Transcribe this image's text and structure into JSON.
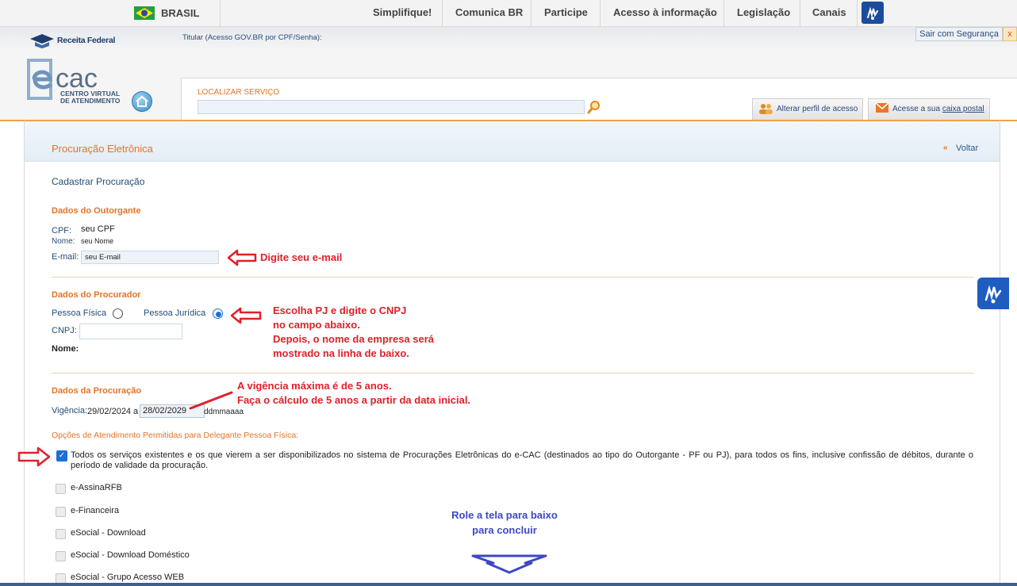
{
  "govbar": {
    "country": "BRASIL",
    "nav": [
      "Simplifique!",
      "Comunica BR",
      "Participe",
      "Acesso à informação",
      "Legislação",
      "Canais"
    ]
  },
  "header": {
    "brand": "Receita Federal",
    "titular": "Titular (Acesso GOV.BR por CPF/Senha):",
    "logout": "Sair com Segurança",
    "logout_close": "x",
    "logo_sub_line1": "CENTRO VIRTUAL",
    "logo_sub_line2": "DE ATENDIMENTO",
    "search_label": "LOCALIZAR SERVIÇO",
    "search_value": "",
    "perfil": "Alterar perfil de acesso",
    "caixa_prefix": "Acesse a sua ",
    "caixa_link": "caixa postal"
  },
  "page": {
    "title": "Procuração Eletrônica",
    "back": "Voltar",
    "section": "Cadastrar Procuração"
  },
  "outorgante": {
    "heading": "Dados do Outorgante",
    "cpf_label": "CPF:",
    "cpf_value": "seu CPF",
    "nome_label": "Nome:",
    "nome_value": "seu Nome",
    "email_label": "E-mail:",
    "email_value": "seu E-mail"
  },
  "procurador": {
    "heading": "Dados do Procurador",
    "pf_label": "Pessoa Física",
    "pj_label": "Pessoa Jurídica",
    "selected": "Pessoa Jurídica",
    "cnpj_label": "CNPJ:",
    "cnpj_value": "",
    "nome_label": "Nome:"
  },
  "procuracao": {
    "heading": "Dados da Procuração",
    "vigencia_label": "Vigência:",
    "start": "29/02/2024",
    "a": "a",
    "end": "28/02/2029",
    "format_hint": "ddmmaaaa"
  },
  "opcoes": {
    "heading": "Opções de Atendimento Permitidas para Delegante Pessoa Física:",
    "todos_checked": true,
    "todos_text": "Todos os serviços existentes e os que vierem a ser disponibilizados no sistema de Procurações Eletrônicas do e-CAC (destinados ao tipo do Outorgante - PF ou PJ), para todos os fins, inclusive confissão de débitos, durante o período de validade da procuração.",
    "services": [
      "e-AssinaRFB",
      "e-Financeira",
      "eSocial - Download",
      "eSocial - Download Doméstico",
      "eSocial - Grupo Acesso WEB"
    ]
  },
  "annotations": {
    "email": "Digite seu e-mail",
    "pj_line1": "Escolha PJ e digite o CNPJ",
    "pj_line2": "no campo abaixo.",
    "pj_line3": "Depois, o nome da empresa será",
    "pj_line4": "mostrado na linha de baixo.",
    "vig_line1": "A vigência máxima é de 5 anos.",
    "vig_line2": "Faça o cálculo de 5 anos a partir da data inicial.",
    "scroll_line1": "Role a tela para baixo",
    "scroll_line2": "para concluir"
  },
  "colors": {
    "accent_orange": "#e2742a",
    "link_blue": "#264c75",
    "annotation_red": "#e0202a",
    "annotation_blue": "#3c48c6"
  }
}
